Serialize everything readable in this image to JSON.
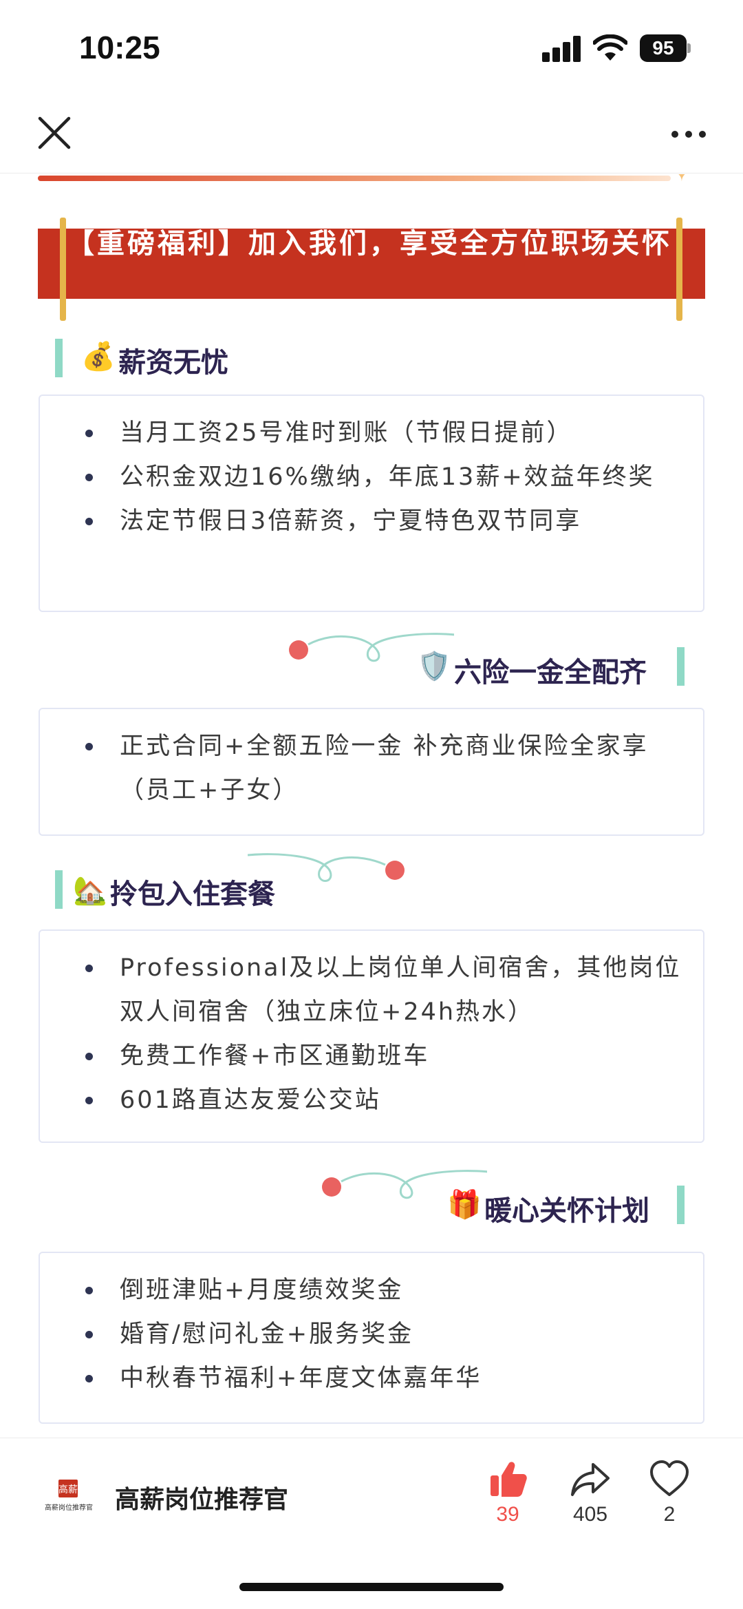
{
  "status_bar": {
    "time": "10:25",
    "battery": "95"
  },
  "banner": {
    "text": "【重磅福利】加入我们，享受全方位职场关怀"
  },
  "sections": [
    {
      "emoji": "💰",
      "title": "薪资无忧",
      "items": [
        "当月工资25号准时到账（节假日提前）",
        "公积金双边16%缴纳，年底13薪+效益年终奖",
        "法定节假日3倍薪资，宁夏特色双节同享"
      ]
    },
    {
      "emoji": "🛡️",
      "title": "六险一金全配齐",
      "items": [
        "正式合同+全额五险一金 补充商业保险全家享（员工+子女）"
      ]
    },
    {
      "emoji": "🏡",
      "title": "拎包入住套餐",
      "items": [
        " Professional及以上岗位单人间宿舍，其他岗位双人间宿舍（独立床位+24h热水）",
        "免费工作餐+市区通勤班车",
        "601路直达友爱公交站"
      ]
    },
    {
      "emoji": "🎁",
      "title": "暖心关怀计划",
      "items": [
        "倒班津贴+月度绩效奖金",
        "婚育/慰问礼金+服务奖金",
        "中秋春节福利+年度文体嘉年华"
      ]
    }
  ],
  "footer": {
    "author": "高薪岗位推荐官",
    "logo_text": "高薪岗位推荐官",
    "likes": "39",
    "shares": "405",
    "favorites": "2"
  },
  "colors": {
    "banner": "#c5321f",
    "accent_bar": "#8fd9c6",
    "like_red": "#f0504a",
    "title_navy": "#2d2450"
  }
}
